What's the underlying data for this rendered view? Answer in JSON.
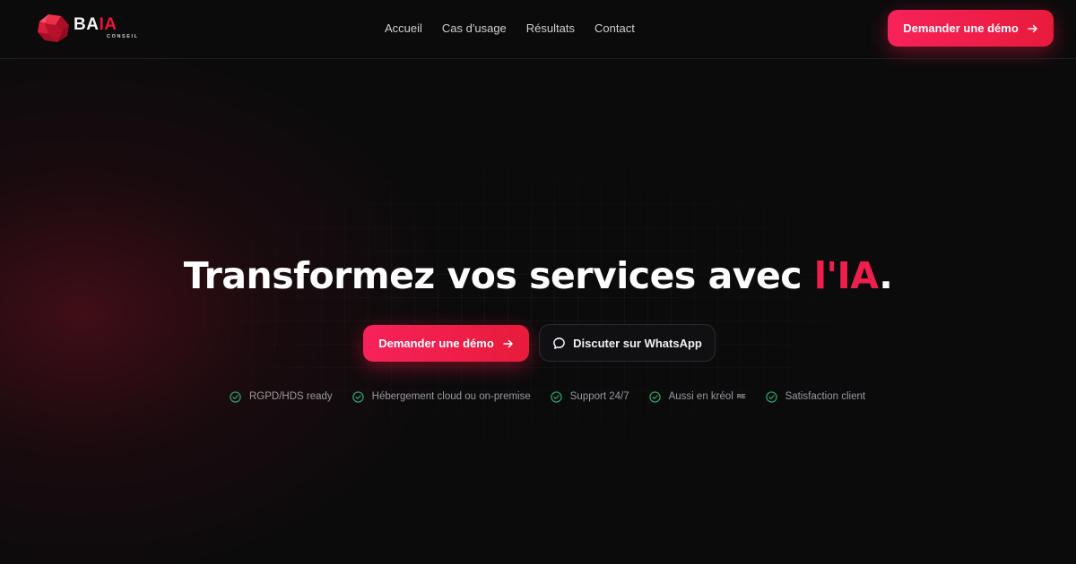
{
  "brand": {
    "name_part1": "BA",
    "name_part2": "IA",
    "subtitle": "CONSEIL",
    "accent_color": "#e8163c"
  },
  "nav": {
    "items": [
      {
        "label": "Accueil"
      },
      {
        "label": "Cas d'usage"
      },
      {
        "label": "Résultats"
      },
      {
        "label": "Contact"
      }
    ]
  },
  "header": {
    "cta_label": "Demander une démo",
    "cta_icon": "arrow-right-icon"
  },
  "hero": {
    "title_main": "Transformez vos services avec ",
    "title_accent": "l'IA",
    "title_end": ".",
    "primary_cta_label": "Demander une démo",
    "secondary_cta_label": "Discuter sur WhatsApp",
    "secondary_cta_icon": "chat-bubble-icon"
  },
  "features": [
    {
      "label": "RGPD/HDS ready",
      "icon": "check-circle-icon"
    },
    {
      "label": "Hébergement cloud ou on-premise",
      "icon": "check-circle-icon"
    },
    {
      "label": "Support 24/7",
      "icon": "check-circle-icon"
    },
    {
      "label": "Aussi en kréol",
      "icon": "check-circle-icon",
      "flag": "RE"
    },
    {
      "label": "Satisfaction client",
      "icon": "check-circle-icon"
    }
  ],
  "colors": {
    "background": "#0b0b0c",
    "primary": "#ee1f4d",
    "check": "#2fa66a",
    "text_muted": "#9a9a9f"
  }
}
